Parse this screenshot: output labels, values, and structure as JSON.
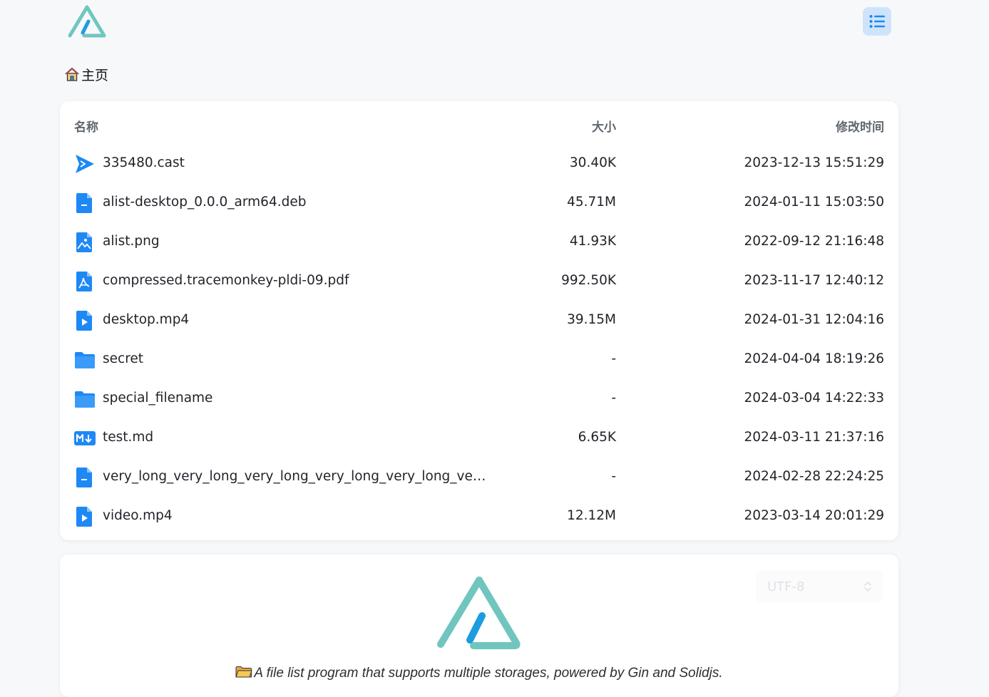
{
  "breadcrumb": {
    "label": "主页"
  },
  "list": {
    "headers": {
      "name": "名称",
      "size": "大小",
      "modified": "修改时间"
    },
    "rows": [
      {
        "icon": "cast-icon",
        "name": "335480.cast",
        "size": "30.40K",
        "modified": "2023-12-13 15:51:29"
      },
      {
        "icon": "file-icon",
        "name": "alist-desktop_0.0.0_arm64.deb",
        "size": "45.71M",
        "modified": "2024-01-11 15:03:50"
      },
      {
        "icon": "image-file-icon",
        "name": "alist.png",
        "size": "41.93K",
        "modified": "2022-09-12 21:16:48"
      },
      {
        "icon": "pdf-file-icon",
        "name": "compressed.tracemonkey-pldi-09.pdf",
        "size": "992.50K",
        "modified": "2023-11-17 12:40:12"
      },
      {
        "icon": "video-file-icon",
        "name": "desktop.mp4",
        "size": "39.15M",
        "modified": "2024-01-31 12:04:16"
      },
      {
        "icon": "folder-icon",
        "name": "secret",
        "size": "-",
        "modified": "2024-04-04 18:19:26"
      },
      {
        "icon": "folder-icon",
        "name": "special_filename",
        "size": "-",
        "modified": "2024-03-04 14:22:33"
      },
      {
        "icon": "markdown-icon",
        "name": "test.md",
        "size": "6.65K",
        "modified": "2024-03-11 21:37:16"
      },
      {
        "icon": "file-icon",
        "name": "very_long_very_long_very_long_very_long_very_long_very_...",
        "size": "-",
        "modified": "2024-02-28 22:24:25"
      },
      {
        "icon": "video-file-icon",
        "name": "video.mp4",
        "size": "12.12M",
        "modified": "2023-03-14 20:01:29"
      }
    ]
  },
  "readme": {
    "encoding": "UTF-8",
    "tagline": "A file list program that supports multiple storages, powered by Gin and Solidjs."
  },
  "colors": {
    "accent": "#1e88f5",
    "logo_teal": "#70c6be",
    "logo_blue": "#1c9de0",
    "menu_bg": "#cfe4fb"
  }
}
